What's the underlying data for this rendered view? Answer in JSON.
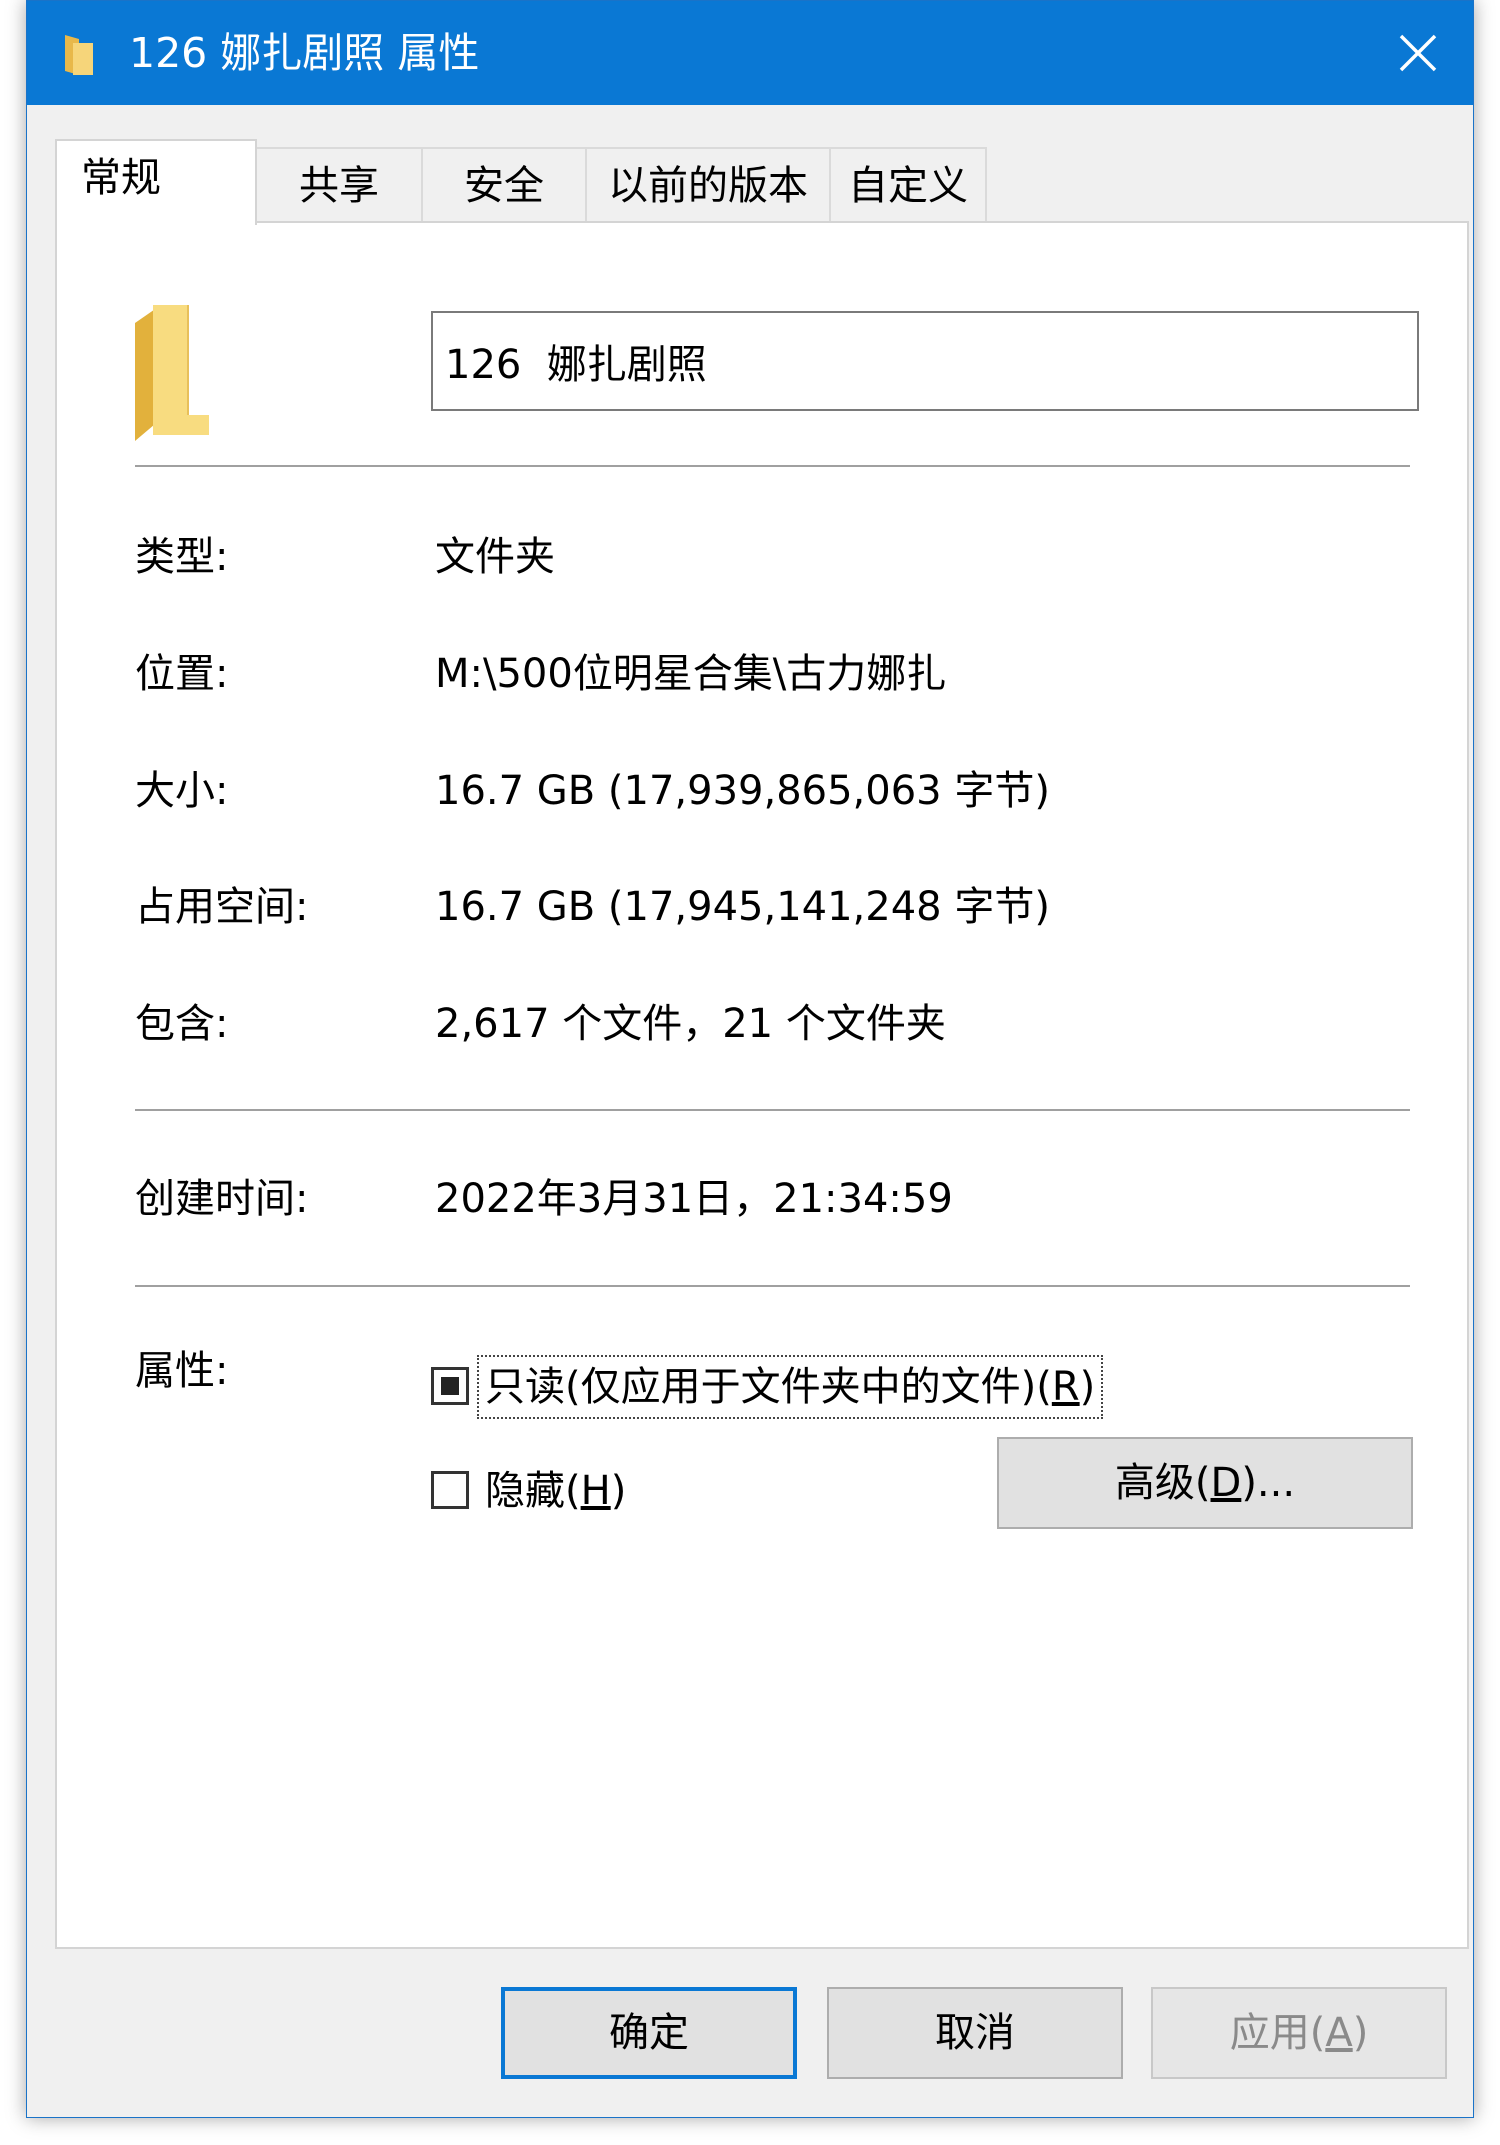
{
  "window": {
    "title": "126  娜扎剧照 属性"
  },
  "tabs": [
    {
      "label": "常规"
    },
    {
      "label": "共享"
    },
    {
      "label": "安全"
    },
    {
      "label": "以前的版本"
    },
    {
      "label": "自定义"
    }
  ],
  "general": {
    "folder_name": "126  娜扎剧照",
    "type_label": "类型:",
    "type_value": "文件夹",
    "location_label": "位置:",
    "location_value": "M:\\500位明星合集\\古力娜扎",
    "size_label": "大小:",
    "size_value": "16.7 GB (17,939,865,063 字节)",
    "disk_label": "占用空间:",
    "disk_value": "16.7 GB (17,945,141,248 字节)",
    "contains_label": "包含:",
    "contains_value": "2,617 个文件，21 个文件夹",
    "created_label": "创建时间:",
    "created_value": "2022年3月31日，21:34:59",
    "attributes_label": "属性:",
    "readonly": {
      "text": "只读(仅应用于文件夹中的文件)(",
      "key": "R",
      "end": ")",
      "state": "indeterminate"
    },
    "hidden": {
      "text": "隐藏(",
      "key": "H",
      "end": ")",
      "checked": false
    },
    "advanced": {
      "text": "高级(",
      "key": "D",
      "end": ")..."
    }
  },
  "buttons": {
    "ok": "确定",
    "cancel": "取消",
    "apply": {
      "text": "应用(",
      "key": "A",
      "end": ")",
      "enabled": false
    }
  },
  "colors": {
    "titlebar": "#0a78d4",
    "folder": "#f4d36b"
  }
}
